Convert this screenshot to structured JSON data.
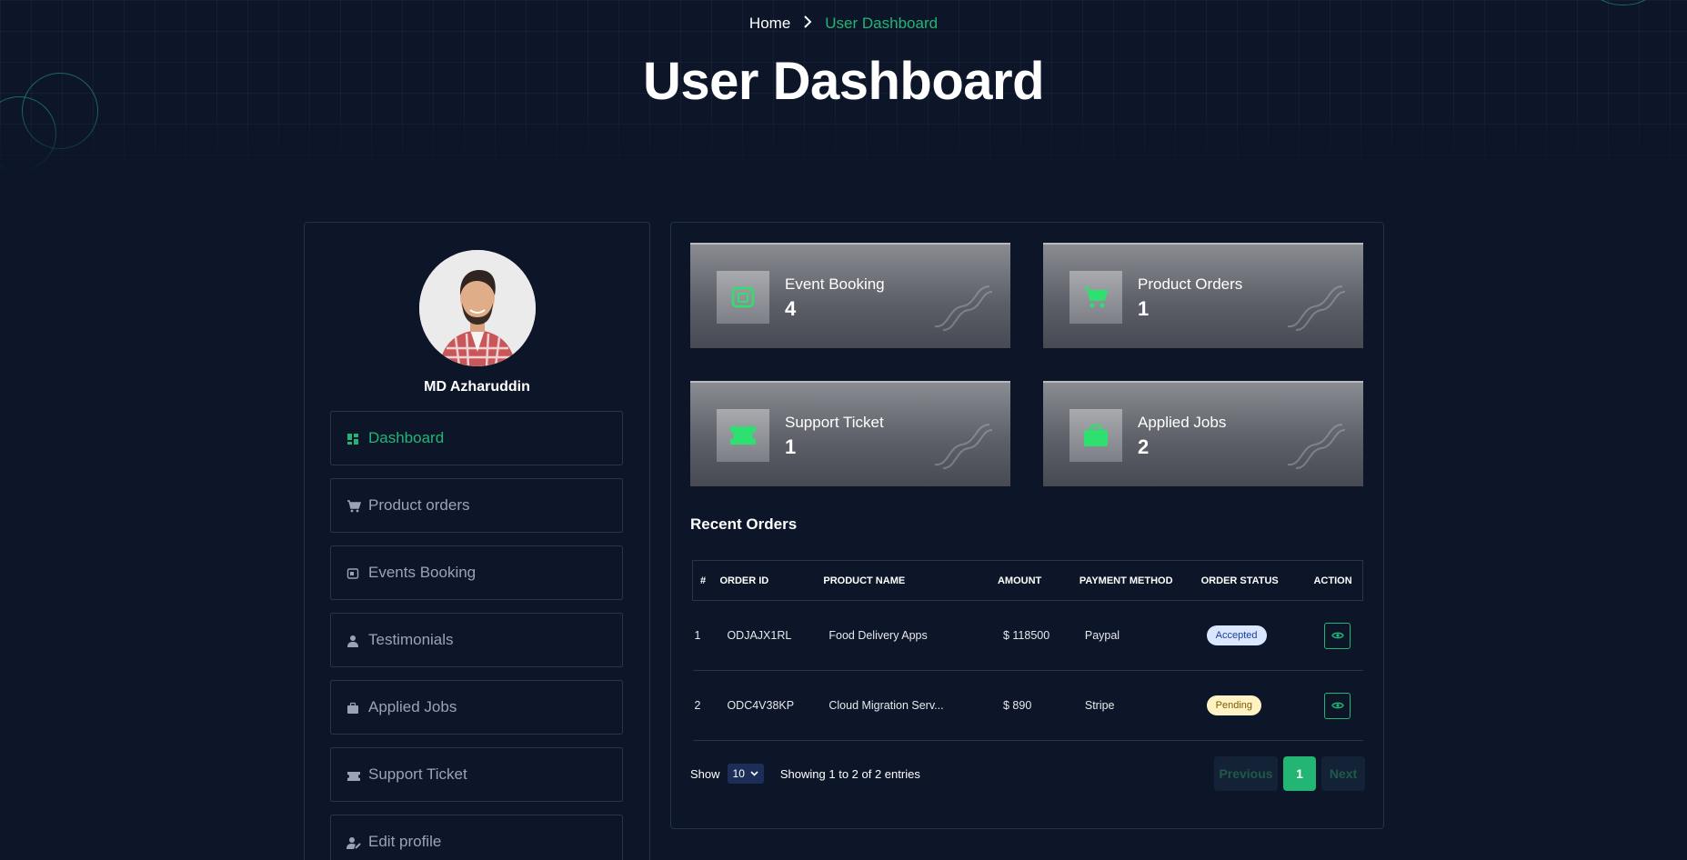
{
  "breadcrumb": {
    "home": "Home",
    "current": "User Dashboard"
  },
  "page_title": "User Dashboard",
  "user": {
    "name": "MD Azharuddin"
  },
  "sidebar": {
    "items": [
      {
        "label": "Dashboard",
        "icon": "dashboard-icon",
        "active": true
      },
      {
        "label": "Product orders",
        "icon": "cart-icon"
      },
      {
        "label": "Events Booking",
        "icon": "calendar-icon"
      },
      {
        "label": "Testimonials",
        "icon": "user-icon"
      },
      {
        "label": "Applied Jobs",
        "icon": "briefcase-icon"
      },
      {
        "label": "Support Ticket",
        "icon": "ticket-icon"
      },
      {
        "label": "Edit profile",
        "icon": "user-edit-icon"
      }
    ]
  },
  "stats": [
    {
      "label": "Event Booking",
      "value": "4",
      "icon": "calendar-icon"
    },
    {
      "label": "Product Orders",
      "value": "1",
      "icon": "cart-icon"
    },
    {
      "label": "Support Ticket",
      "value": "1",
      "icon": "ticket-icon"
    },
    {
      "label": "Applied Jobs",
      "value": "2",
      "icon": "briefcase-icon"
    }
  ],
  "recent_orders": {
    "title": "Recent Orders",
    "columns": [
      "#",
      "ORDER ID",
      "PRODUCT NAME",
      "AMOUNT",
      "PAYMENT METHOD",
      "ORDER STATUS",
      "ACTION"
    ],
    "rows": [
      {
        "num": "1",
        "order_id": "ODJAJX1RL",
        "product": "Food Delivery Apps",
        "amount": "$ 118500",
        "payment": "Paypal",
        "status": "Accepted"
      },
      {
        "num": "2",
        "order_id": "ODC4V38KP",
        "product": "Cloud Migration Serv...",
        "amount": "$ 890",
        "payment": "Stripe",
        "status": "Pending"
      }
    ],
    "show_label": "Show",
    "page_size": "10",
    "entries_info": "Showing 1 to 2 of 2 entries",
    "pager": {
      "previous": "Previous",
      "current": "1",
      "next": "Next"
    }
  },
  "colors": {
    "accent": "#22b573",
    "background": "#0d1629"
  }
}
